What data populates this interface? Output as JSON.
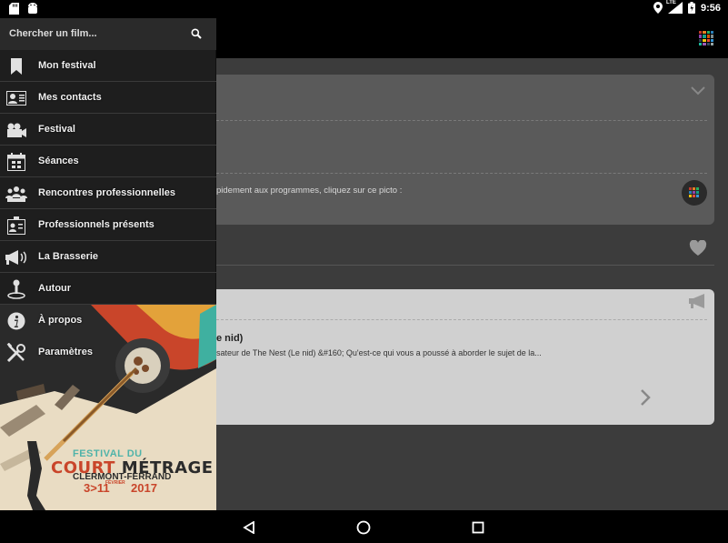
{
  "status_bar": {
    "time": "9:56",
    "network": "LTE",
    "icons": [
      "sd-card-icon",
      "android-icon",
      "location-icon",
      "signal-icon",
      "battery-icon"
    ]
  },
  "drawer": {
    "search": {
      "placeholder": "Chercher un film...",
      "value": ""
    },
    "items": [
      {
        "label": "Mon festival",
        "icon": "bookmark-icon"
      },
      {
        "label": "Mes contacts",
        "icon": "contact-card-icon"
      },
      {
        "label": "Festival",
        "icon": "camera-icon"
      },
      {
        "label": "Séances",
        "icon": "calendar-icon"
      },
      {
        "label": "Rencontres professionnelles",
        "icon": "people-group-icon"
      },
      {
        "label": "Professionnels présents",
        "icon": "badge-icon"
      },
      {
        "label": "La Brasserie",
        "icon": "megaphone-icon"
      },
      {
        "label": "Autour",
        "icon": "map-pin-icon"
      },
      {
        "label": "À propos",
        "icon": "info-icon"
      },
      {
        "label": "Paramètres",
        "icon": "tools-icon"
      }
    ],
    "poster": {
      "line1": "FESTIVAL DU",
      "line2_a": "COURT",
      "line2_b": "MÉTRAGE",
      "line3": "CLERMONT-FERRAND",
      "dates": "3>11",
      "month": "FÉVRIER",
      "year": "2017"
    }
  },
  "background": {
    "info_text": "pidement aux programmes, cliquez sur ce picto :",
    "news_title": "e nid)",
    "news_body": "sateur de The Nest (Le nid) &#160;  Qu'est-ce qui vous a poussé à aborder le sujet de la..."
  },
  "colors": {
    "drawer_bg": "#1e1e1e",
    "accent_teal": "#4fb3a9",
    "accent_red": "#c9452a"
  }
}
